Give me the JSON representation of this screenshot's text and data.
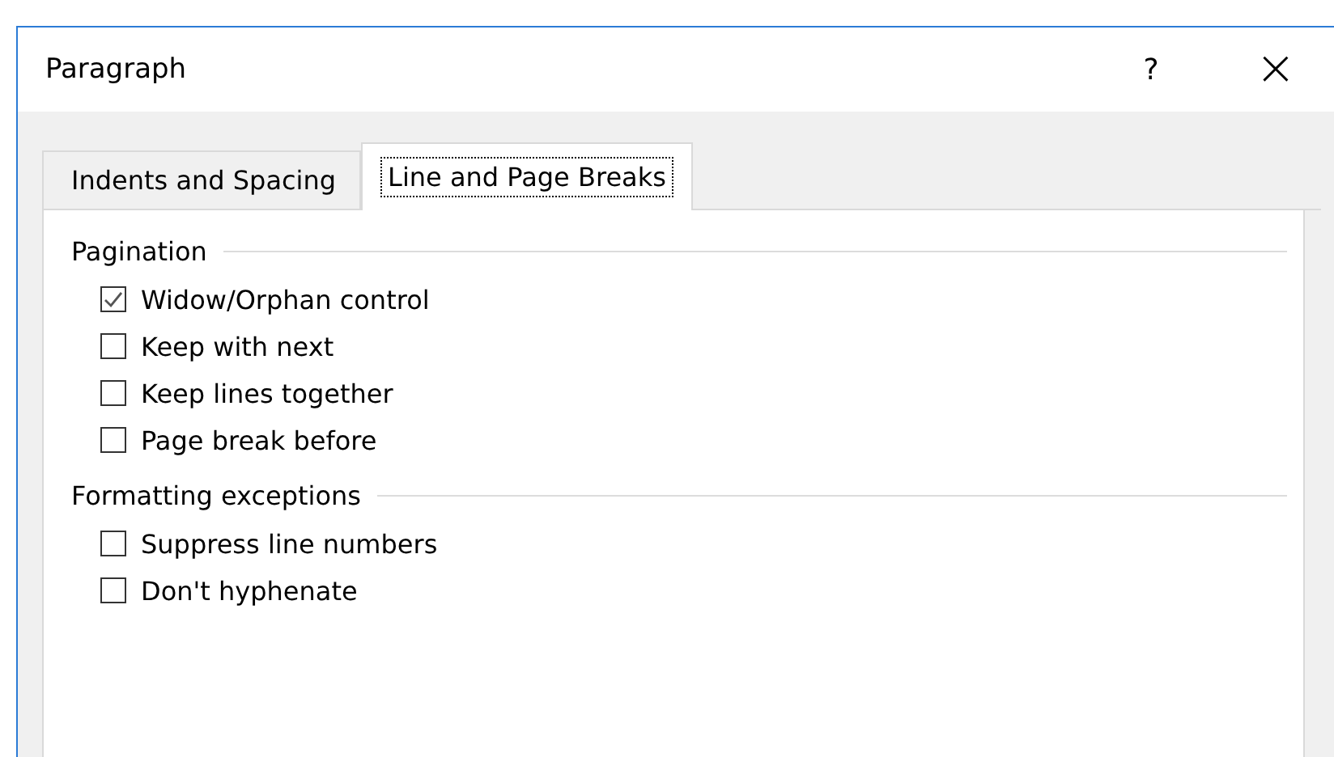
{
  "window": {
    "title": "Paragraph",
    "help": "?",
    "close": "×"
  },
  "tabs": [
    {
      "label": "Indents and Spacing",
      "selected": false
    },
    {
      "label": "Line and Page Breaks",
      "selected": true
    }
  ],
  "sections": [
    {
      "title": "Pagination",
      "options": [
        {
          "label": "Widow/Orphan control",
          "checked": true
        },
        {
          "label": "Keep with next",
          "checked": false
        },
        {
          "label": "Keep lines together",
          "checked": false
        },
        {
          "label": "Page break before",
          "checked": false
        }
      ]
    },
    {
      "title": "Formatting exceptions",
      "options": [
        {
          "label": "Suppress line numbers",
          "checked": false
        },
        {
          "label": "Don't hyphenate",
          "checked": false
        }
      ]
    }
  ]
}
